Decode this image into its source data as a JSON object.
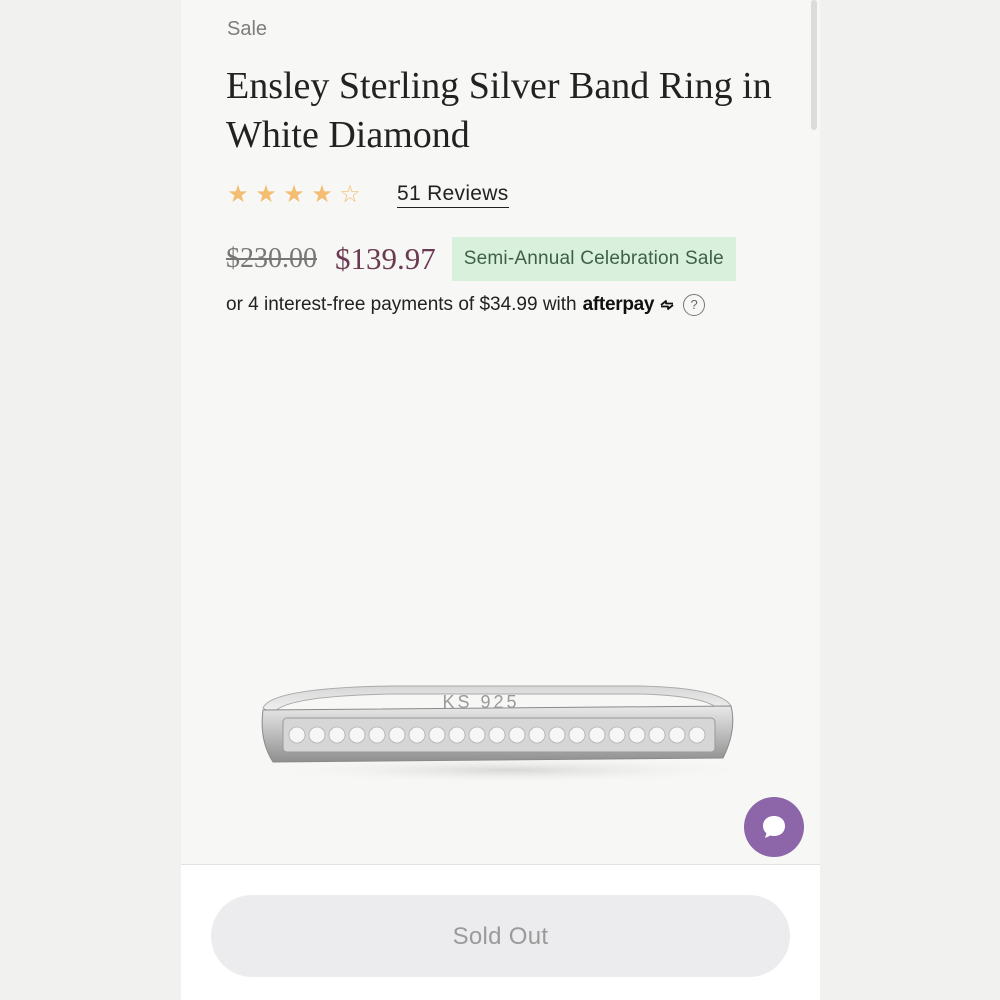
{
  "product": {
    "sale_label": "Sale",
    "title": "Ensley Sterling Silver Band Ring in White Diamond",
    "rating": 4,
    "rating_max": 5,
    "reviews_label": "51 Reviews",
    "original_price": "$230.00",
    "sale_price": "$139.97",
    "promo_badge": "Semi-Annual Celebration Sale",
    "installment_text": "or 4 interest-free payments of $34.99 with",
    "installment_provider": "afterpay",
    "ring_engraving": "KS 925"
  },
  "actions": {
    "sold_out_label": "Sold Out"
  },
  "icons": {
    "star": "star-icon",
    "help": "question-mark-icon",
    "chat": "chat-bubble-icon",
    "afterpay": "afterpay-loop-icon"
  },
  "colors": {
    "star": "#f4bd72",
    "sale_price": "#6b3a52",
    "badge_bg": "#d9f0dc",
    "badge_text": "#3f6048",
    "chat_button": "#8c66a8",
    "sold_out_bg": "#ececee"
  }
}
